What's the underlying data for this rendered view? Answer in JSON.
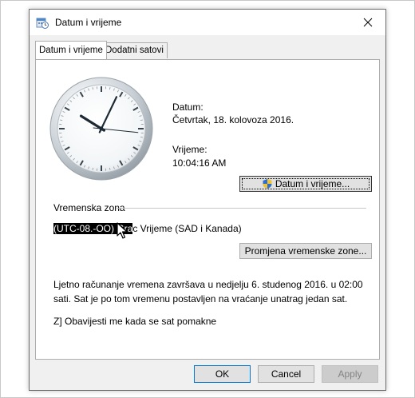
{
  "window": {
    "title": "Datum i vrijeme",
    "icons": {
      "app": "clock-calendar-icon",
      "close": "close-icon",
      "shield": "uac-shield-icon",
      "cursor": "mouse-pointer-icon"
    }
  },
  "tabs": [
    {
      "label": "Datum i vrijeme",
      "active": true
    },
    {
      "label": "Dodatni satovi",
      "active": false
    }
  ],
  "clock": {
    "hours": 10,
    "minutes": 4,
    "seconds": 16
  },
  "date": {
    "label": "Datum:",
    "value": "Četvrtak, 18. kolovoza 2016."
  },
  "time": {
    "label": "Vrijeme:",
    "value": "10:04:16 AM"
  },
  "buttons": {
    "change_datetime": "Datum i vrijeme...",
    "change_timezone": "Promjena vremenske zone...",
    "ok": "OK",
    "cancel": "Cancel",
    "apply": "Apply"
  },
  "timezone": {
    "group_label": "Vremenska zona",
    "selected_part": "(UTC-08.-OO) Gra",
    "rest": "c Vrijeme (SAD i Kanada)"
  },
  "dst_notice": "Ljetno računanje vremena završava u nedjelju 6. studenog 2016. u 02:00 sati. Sat je po tom vremenu postavljen na vraćanje unatrag jedan sat.",
  "notify_text": "Z] Obavijesti me kada se sat pomakne"
}
